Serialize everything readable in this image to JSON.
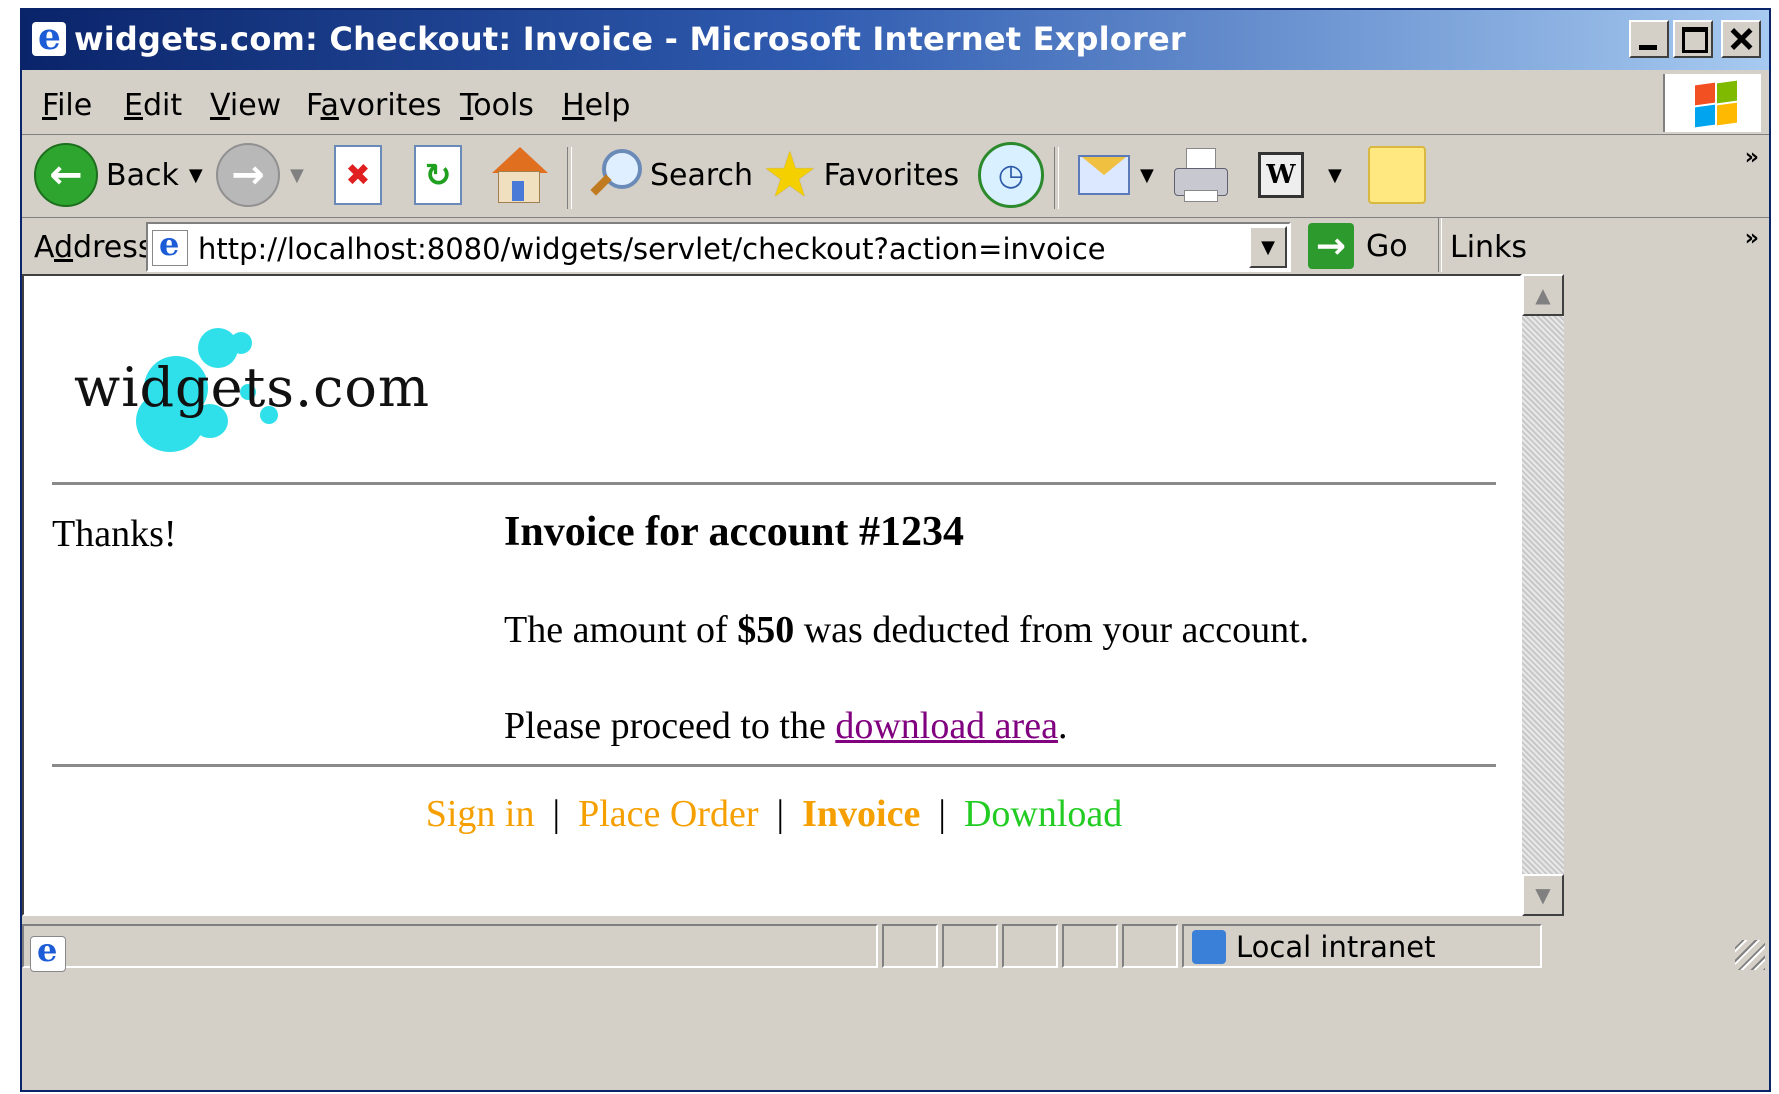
{
  "window": {
    "title": "widgets.com: Checkout: Invoice - Microsoft Internet Explorer"
  },
  "menu": {
    "file": {
      "pre": "",
      "u": "F",
      "post": "ile"
    },
    "edit": {
      "pre": "",
      "u": "E",
      "post": "dit"
    },
    "view": {
      "pre": "",
      "u": "V",
      "post": "iew"
    },
    "favorites": {
      "pre": "F",
      "u": "a",
      "post": "vorites"
    },
    "tools": {
      "pre": "",
      "u": "T",
      "post": "ools"
    },
    "help": {
      "pre": "",
      "u": "H",
      "post": "elp"
    }
  },
  "toolbar": {
    "back_label": "Back",
    "search_label": "Search",
    "favorites_label": "Favorites",
    "chevron": "»"
  },
  "address": {
    "label_pre": "A",
    "label_u": "d",
    "label_post": "dress",
    "url": "http://localhost:8080/widgets/servlet/checkout?action=invoice",
    "go_label": "Go",
    "links_label": "Links",
    "chevron": "»"
  },
  "page": {
    "logo_text": "widgets.com",
    "thanks": "Thanks!",
    "invoice_title": "Invoice for account #1234",
    "amount_pre": "The amount of ",
    "amount_value": "$50",
    "amount_post": " was deducted from your account.",
    "proceed_pre": "Please proceed to the ",
    "proceed_link": "download area",
    "proceed_post": ".",
    "nav": {
      "sign_in": "Sign in",
      "place_order": "Place Order",
      "invoice": "Invoice",
      "download": "Download",
      "separator": "|"
    }
  },
  "status": {
    "zone": "Local intranet"
  },
  "colors": {
    "nav_orange": "#f5a000",
    "nav_green": "#22cc22",
    "visited_link": "#800080",
    "logo_dots": "#2fe0ea"
  }
}
